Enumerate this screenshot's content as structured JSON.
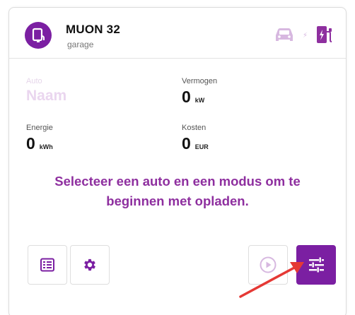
{
  "header": {
    "title": "MUON 32",
    "subtitle": "garage",
    "icons": [
      "car-icon",
      "bolt-icon",
      "charging-station-icon"
    ]
  },
  "fields": {
    "auto": {
      "label": "Auto",
      "value": "Naam"
    },
    "vermogen": {
      "label": "Vermogen",
      "value": "0",
      "unit": "kW"
    },
    "energie": {
      "label": "Energie",
      "value": "0",
      "unit": "kWh"
    },
    "kosten": {
      "label": "Kosten",
      "value": "0",
      "unit": "EUR"
    }
  },
  "prompt": {
    "line1": "Selecteer een auto en een modus om te",
    "line2": "beginnen met opladen."
  },
  "colors": {
    "accent": "#7b1fa2",
    "prompt_text": "#8e2f9f",
    "faded_icon": "#d7b8e0",
    "annotation_arrow": "#e53935"
  }
}
